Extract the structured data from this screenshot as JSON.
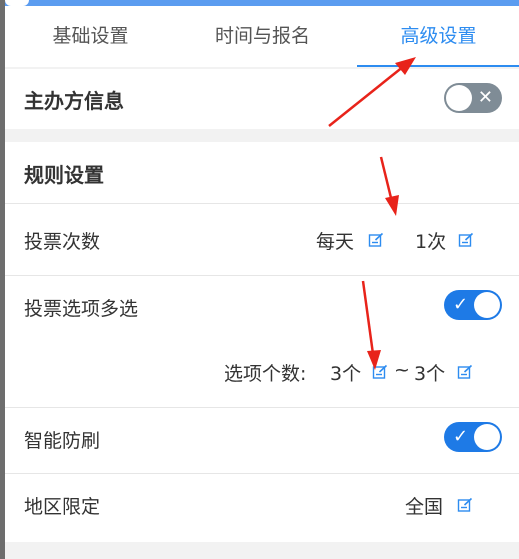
{
  "tabs": [
    {
      "label": "基础设置",
      "active": false
    },
    {
      "label": "时间与报名",
      "active": false
    },
    {
      "label": "高级设置",
      "active": true
    }
  ],
  "organizer": {
    "label": "主办方信息",
    "toggle": "off"
  },
  "rules": {
    "title": "规则设置",
    "vote_count": {
      "label": "投票次数",
      "period": "每天",
      "times": "1次"
    },
    "multi_select": {
      "label": "投票选项多选",
      "toggle": "on",
      "count_label": "选项个数:",
      "min": "3个",
      "separator": "~",
      "max": "3个"
    },
    "anti_fraud": {
      "label": "智能防刷",
      "toggle": "on"
    },
    "region": {
      "label": "地区限定",
      "value": "全国"
    }
  },
  "icons": {
    "edit": "edit-square-icon",
    "check": "check-icon",
    "close": "close-x-icon"
  },
  "colors": {
    "accent": "#2d8cf0",
    "toggle_on": "#1e7ae6",
    "toggle_off": "#7f8c96",
    "annotation": "#e8231a"
  }
}
